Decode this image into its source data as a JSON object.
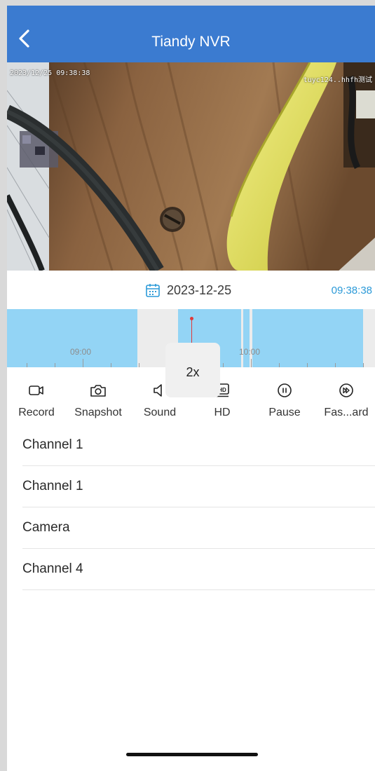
{
  "header": {
    "title": "Tiandy NVR",
    "background": "#3b7bd0"
  },
  "video": {
    "osd_timestamp": "2023/12/25 09:38:38",
    "osd_channel_name": "tuyc124..hhfh测试"
  },
  "playback": {
    "date": "2023-12-25",
    "current_time": "09:38:38",
    "accent": "#2c9ad8"
  },
  "timeline": {
    "labels": [
      "09:00",
      "10:00"
    ],
    "speed": "2x",
    "recorded_color": "#93d4f5",
    "cursor_color": "#e03a3a"
  },
  "toolbar": {
    "items": [
      {
        "label": "Record",
        "icon": "video-camera-icon"
      },
      {
        "label": "Snapshot",
        "icon": "camera-icon"
      },
      {
        "label": "Sound",
        "icon": "speaker-icon"
      },
      {
        "label": "HD",
        "icon": "hd-icon"
      },
      {
        "label": "Pause",
        "icon": "pause-icon"
      },
      {
        "label": "Fas...ard",
        "icon": "fast-forward-icon"
      }
    ]
  },
  "channels": [
    {
      "name": "Channel 1"
    },
    {
      "name": "Channel 1"
    },
    {
      "name": "Camera"
    },
    {
      "name": "Channel 4"
    }
  ]
}
